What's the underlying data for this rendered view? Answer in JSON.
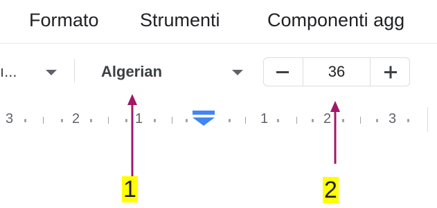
{
  "menu": {
    "items": [
      "Formato",
      "Strumenti",
      "Componenti agg"
    ]
  },
  "toolbar": {
    "style_select": {
      "label": "ı..."
    },
    "font_select": {
      "value": "Algerian"
    },
    "font_size": {
      "value": "36"
    }
  },
  "ruler": {
    "labels": [
      "3",
      "2",
      "1",
      "1",
      "2",
      "3"
    ]
  },
  "annotations": {
    "callout_1": "1",
    "callout_2": "2",
    "callout_color": "#ffff00",
    "arrow_color": "#a0186b"
  },
  "colors": {
    "indent_marker": "#4285f4",
    "border": "#dadce0",
    "text": "#3c4043"
  }
}
